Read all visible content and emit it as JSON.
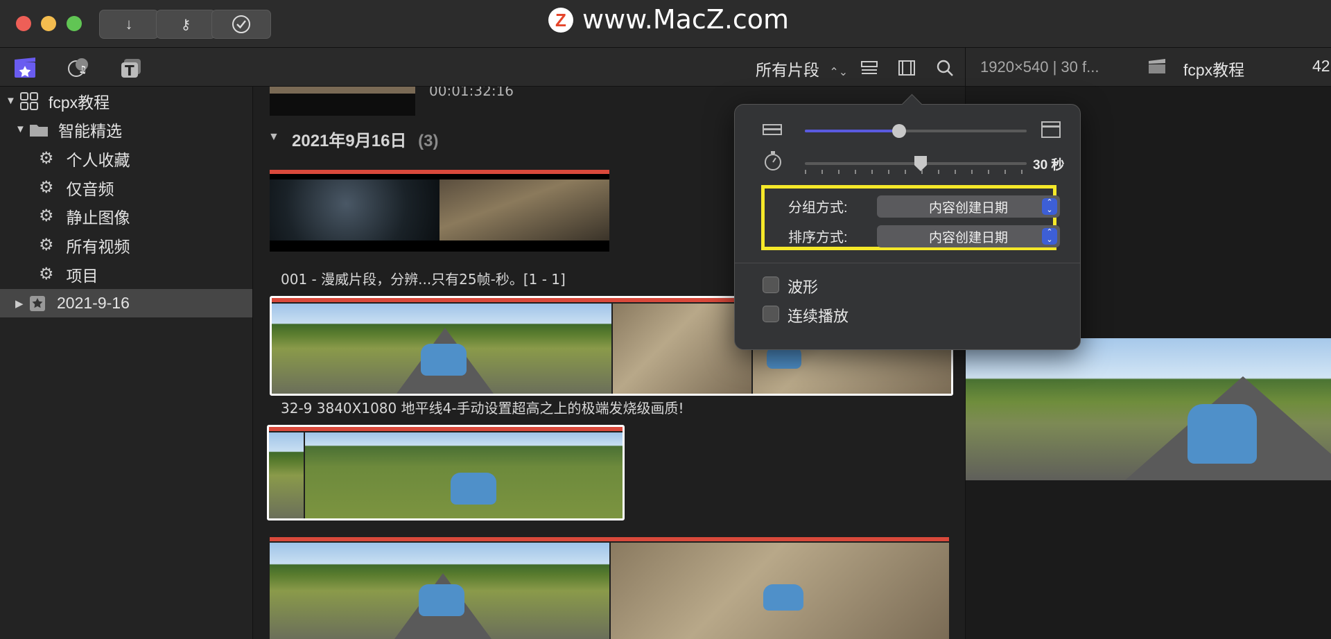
{
  "titlebar": {
    "watermark_logo": "Z",
    "watermark_text": "www.MacZ.com",
    "buttons": [
      {
        "icon": "import-arrow-icon"
      },
      {
        "icon": "key-icon"
      },
      {
        "icon": "checkmark-icon"
      }
    ]
  },
  "toolbar": {
    "filter_label": "所有片段",
    "viewer_info": "1920×540 | 30 f...",
    "project_name": "fcpx教程",
    "counter_partial": "42"
  },
  "sidebar": {
    "library": "fcpx教程",
    "smart_folder": "智能精选",
    "items": [
      "个人收藏",
      "仅音频",
      "静止图像",
      "所有视频",
      "项目"
    ],
    "event": "2021-9-16"
  },
  "browser": {
    "top_timecode": "00:01:32:16",
    "date_group": "2021年9月16日",
    "date_count": "(3)",
    "clip1_caption": "001 - 漫威片段，分辨...只有25帧-秒。[1 - 1]",
    "clip2_caption": "32-9 3840X1080 地平线4-手动设置超高之上的极端发烧级画质!"
  },
  "popover": {
    "duration_label": "30 秒",
    "group_label": "分组方式:",
    "group_value": "内容创建日期",
    "sort_label": "排序方式:",
    "sort_value": "内容创建日期",
    "waveform_label": "波形",
    "continuous_label": "连续播放",
    "highlight_color": "#f5e829",
    "accent_color": "#5a5ae0"
  }
}
